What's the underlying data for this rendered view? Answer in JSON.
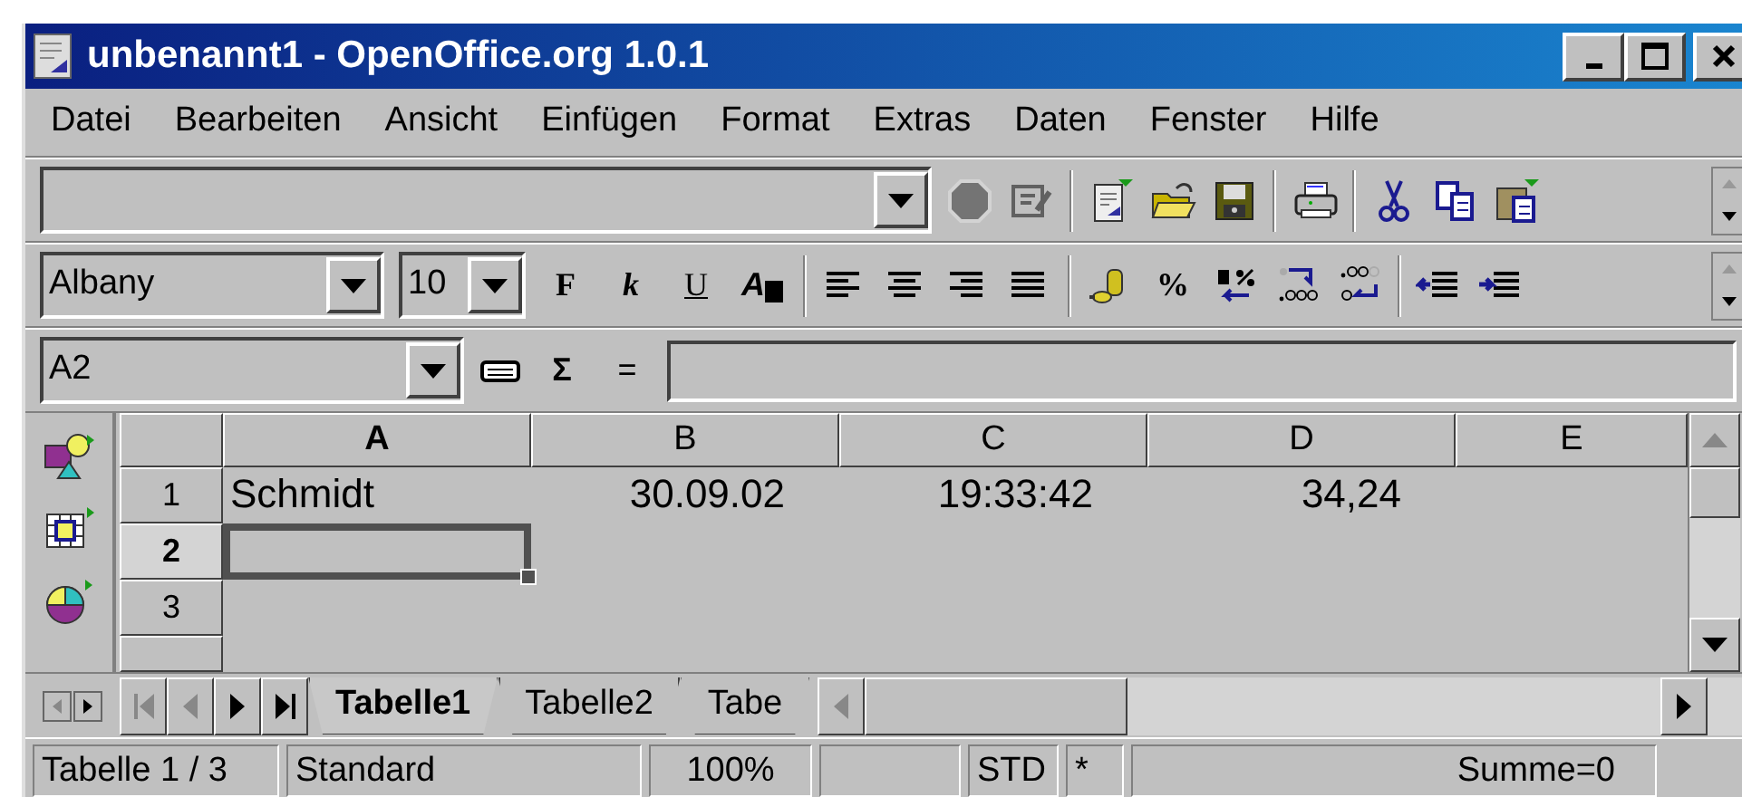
{
  "window": {
    "title": "unbenannt1 - OpenOffice.org 1.0.1"
  },
  "menu": [
    {
      "label": "Datei"
    },
    {
      "label": "Bearbeiten"
    },
    {
      "label": "Ansicht"
    },
    {
      "label": "Einfügen"
    },
    {
      "label": "Format"
    },
    {
      "label": "Extras"
    },
    {
      "label": "Daten"
    },
    {
      "label": "Fenster"
    },
    {
      "label": "Hilfe"
    }
  ],
  "function_bar": {
    "tools": [
      {
        "kind": "stop",
        "disabled": true
      },
      {
        "kind": "edit",
        "disabled": true
      },
      {
        "kind": "sep"
      },
      {
        "kind": "new",
        "disabled": false
      },
      {
        "kind": "open",
        "disabled": false
      },
      {
        "kind": "save",
        "disabled": false
      },
      {
        "kind": "sep"
      },
      {
        "kind": "print",
        "disabled": false
      },
      {
        "kind": "sep"
      },
      {
        "kind": "cut",
        "disabled": false
      },
      {
        "kind": "copy",
        "disabled": false
      },
      {
        "kind": "paste",
        "disabled": false
      }
    ]
  },
  "format_bar": {
    "font": "Albany",
    "size": "10",
    "tools": [
      {
        "kind": "bold",
        "label": "F"
      },
      {
        "kind": "italic",
        "label": "k"
      },
      {
        "kind": "underline",
        "label": "U"
      },
      {
        "kind": "fontcolor",
        "label": "A"
      },
      {
        "kind": "sep"
      },
      {
        "kind": "align-left"
      },
      {
        "kind": "align-center"
      },
      {
        "kind": "align-right"
      },
      {
        "kind": "justify"
      },
      {
        "kind": "sep"
      },
      {
        "kind": "currency"
      },
      {
        "kind": "percent",
        "label": "%"
      },
      {
        "kind": "standard"
      },
      {
        "kind": "add-decimal"
      },
      {
        "kind": "del-decimal"
      },
      {
        "kind": "sep"
      },
      {
        "kind": "indent-less"
      },
      {
        "kind": "indent-more"
      }
    ]
  },
  "formula_bar": {
    "cell_ref": "A2",
    "sum_symbol": "Σ",
    "equals": "="
  },
  "sheet": {
    "columns": [
      {
        "label": "A",
        "selected": true
      },
      {
        "label": "B",
        "selected": false
      },
      {
        "label": "C",
        "selected": false
      },
      {
        "label": "D",
        "selected": false
      },
      {
        "label": "E",
        "selected": false
      }
    ],
    "rows": [
      {
        "label": "1",
        "selected": false,
        "cells": [
          {
            "kind": "text",
            "value": "Schmidt"
          },
          {
            "kind": "number",
            "value": "30.09.02"
          },
          {
            "kind": "number",
            "value": "19:33:42"
          },
          {
            "kind": "number",
            "value": "34,24"
          },
          {
            "kind": "empty"
          }
        ]
      },
      {
        "label": "2",
        "selected": true,
        "cells": [
          {
            "kind": "empty",
            "active": true
          },
          {
            "kind": "empty"
          },
          {
            "kind": "empty"
          },
          {
            "kind": "empty"
          },
          {
            "kind": "empty"
          }
        ]
      },
      {
        "label": "3",
        "selected": false,
        "cells": [
          {
            "kind": "empty"
          },
          {
            "kind": "empty"
          },
          {
            "kind": "empty"
          },
          {
            "kind": "empty"
          },
          {
            "kind": "empty"
          }
        ]
      }
    ]
  },
  "sheet_tabs": [
    {
      "label": "Tabelle1",
      "selected": true
    },
    {
      "label": "Tabelle2",
      "selected": false
    },
    {
      "label": "Tabe",
      "selected": false
    }
  ],
  "status_bar": [
    {
      "kind": "text",
      "text": "Tabelle 1 / 3"
    },
    {
      "kind": "text",
      "text": "Standard"
    },
    {
      "kind": "text",
      "text": "100%"
    },
    {
      "kind": "blank"
    },
    {
      "kind": "text",
      "text": "STD"
    },
    {
      "kind": "text",
      "text": "*"
    },
    {
      "kind": "text",
      "text": "Summe=0"
    }
  ]
}
